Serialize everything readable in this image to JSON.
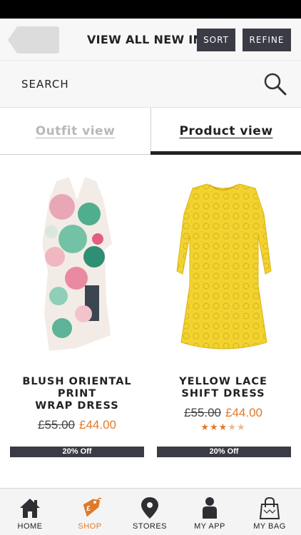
{
  "header": {
    "title": "VIEW ALL NEW IN",
    "sort_label": "SORT",
    "refine_label": "REFINE"
  },
  "search": {
    "label": "SEARCH"
  },
  "view_tabs": {
    "outfit": "Outfit view",
    "product": "Product view",
    "active": "product"
  },
  "products": [
    {
      "name_line1": "BLUSH ORIENTAL PRINT",
      "name_line2": "WRAP DRESS",
      "price_was": "£55.00",
      "price_now": "£44.00",
      "rating": 0,
      "discount": "20% Off"
    },
    {
      "name_line1": "YELLOW LACE",
      "name_line2": "SHIFT DRESS",
      "price_was": "£55.00",
      "price_now": "£44.00",
      "rating": 3,
      "rating_max": 5,
      "discount": "20% Off"
    }
  ],
  "tab_bar": {
    "items": [
      {
        "label": "HOME",
        "icon": "home-icon"
      },
      {
        "label": "SHOP",
        "icon": "price-tag-icon"
      },
      {
        "label": "STORES",
        "icon": "map-pin-icon"
      },
      {
        "label": "MY APP",
        "icon": "person-icon"
      },
      {
        "label": "MY BAG",
        "icon": "shopping-bag-icon"
      }
    ],
    "active": "SHOP"
  },
  "colors": {
    "accent": "#e07a2b",
    "dark_button": "#3a3b44",
    "header_bg": "#f7f7f7"
  }
}
